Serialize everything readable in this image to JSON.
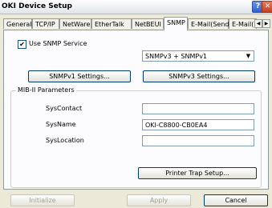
{
  "window": {
    "title": "OKI Device Setup",
    "help_glyph": "?",
    "close_glyph": "✕"
  },
  "tabs": [
    {
      "label": "General"
    },
    {
      "label": "TCP/IP"
    },
    {
      "label": "NetWare"
    },
    {
      "label": "EtherTalk"
    },
    {
      "label": "NetBEUI"
    },
    {
      "label": "SNMP",
      "active": true
    },
    {
      "label": "E-Mail(Send)"
    },
    {
      "label": "E-Mail("
    }
  ],
  "snmp": {
    "use_snmp_label": "Use SNMP Service",
    "use_snmp_checked": true,
    "check_glyph": "✔",
    "version_select": "SNMPv3 + SNMPv1",
    "v1_settings_label": "SNMPv1 Settings...",
    "v3_settings_label": "SNMPv3 Settings..."
  },
  "mib": {
    "group_label": "MIB-II Parameters",
    "syscontact_label": "SysContact",
    "syscontact_value": "",
    "sysname_label": "SysName",
    "sysname_value": "OKI-C8800-CB0EA4",
    "syslocation_label": "SysLocation",
    "syslocation_value": "",
    "printer_trap_label": "Printer Trap Setup..."
  },
  "footer": {
    "initialize_label": "Initialize",
    "apply_label": "Apply",
    "cancel_label": "Cancel"
  }
}
